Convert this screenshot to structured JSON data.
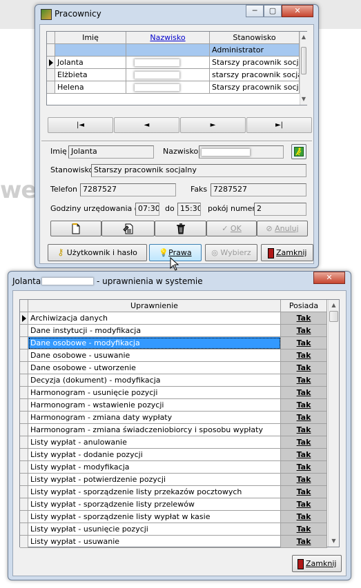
{
  "background": {
    "fragment": "we"
  },
  "pracownicy": {
    "title": "Pracownicy",
    "columns": [
      "Imię",
      "Nazwisko",
      "Stanowisko"
    ],
    "rows": [
      {
        "imie": "",
        "stanowisko": "Administrator",
        "selected": true
      },
      {
        "imie": "Jolanta",
        "stanowisko": "Starszy pracownik socjalny",
        "current": true
      },
      {
        "imie": "Elżbieta",
        "stanowisko": "starszy pracownik socjalny"
      },
      {
        "imie": "Helena",
        "stanowisko": "Starszy pracownik socjalny"
      }
    ],
    "nav": {
      "first": "|◄",
      "prev": "◄",
      "next": "►",
      "last": "►|"
    },
    "form": {
      "imie_label": "Imię",
      "imie_value": "Jolanta",
      "nazwisko_label": "Nazwisko",
      "stanowisko_label": "Stanowisko",
      "stanowisko_value": "Starszy pracownik socjalny",
      "telefon_label": "Telefon",
      "telefon_value": "7287527",
      "faks_label": "Faks",
      "faks_value": "7287527",
      "godziny_label": "Godziny urzędowania od",
      "od_value": "07:30",
      "do_label": "do",
      "do_value": "15:30",
      "pokoj_label": "pokój numer",
      "pokoj_value": "2"
    },
    "actions": {
      "ok": "OK",
      "anuluj": "Anuluj"
    },
    "bottom": {
      "uzytkownik": "Użytkownik i hasło",
      "prawa": "Prawa",
      "wybierz": "Wybierz",
      "zamknij": "Zamknij"
    }
  },
  "uprawnienia": {
    "title_name": "Jolanta",
    "title_rest": "- uprawnienia w systemie",
    "columns": [
      "Uprawnienie",
      "Posiada"
    ],
    "rows": [
      {
        "name": "Archiwizacja danych",
        "value": "Tak"
      },
      {
        "name": "Dane instytucji - modyfikacja",
        "value": "Tak"
      },
      {
        "name": "Dane osobowe - modyfikacja",
        "value": "Tak",
        "selected": true
      },
      {
        "name": "Dane osobowe - usuwanie",
        "value": "Tak"
      },
      {
        "name": "Dane osobowe - utworzenie",
        "value": "Tak"
      },
      {
        "name": "Decyzja (dokument) - modyfikacja",
        "value": "Tak"
      },
      {
        "name": "Harmonogram - usunięcie pozycji",
        "value": "Tak"
      },
      {
        "name": "Harmonogram - wstawienie pozycji",
        "value": "Tak"
      },
      {
        "name": "Harmonogram - zmiana daty wypłaty",
        "value": "Tak"
      },
      {
        "name": "Harmonogram - zmiana świadczeniobiorcy i sposobu wypłaty",
        "value": "Tak"
      },
      {
        "name": "Listy wypłat - anulowanie",
        "value": "Tak"
      },
      {
        "name": "Listy wypłat - dodanie pozycji",
        "value": "Tak"
      },
      {
        "name": "Listy wypłat - modyfikacja",
        "value": "Tak"
      },
      {
        "name": "Listy wypłat - potwierdzenie pozycji",
        "value": "Tak"
      },
      {
        "name": "Listy wypłat - sporządzenie listy przekazów pocztowych",
        "value": "Tak"
      },
      {
        "name": "Listy wypłat - sporządzenie listy przelewów",
        "value": "Tak"
      },
      {
        "name": "Listy wypłat - sporządzenie listy wypłat w kasie",
        "value": "Tak"
      },
      {
        "name": "Listy wypłat - usunięcie pozycji",
        "value": "Tak"
      },
      {
        "name": "Listy wypłat - usuwanie",
        "value": "Tak"
      }
    ],
    "zamknij": "Zamknij"
  }
}
